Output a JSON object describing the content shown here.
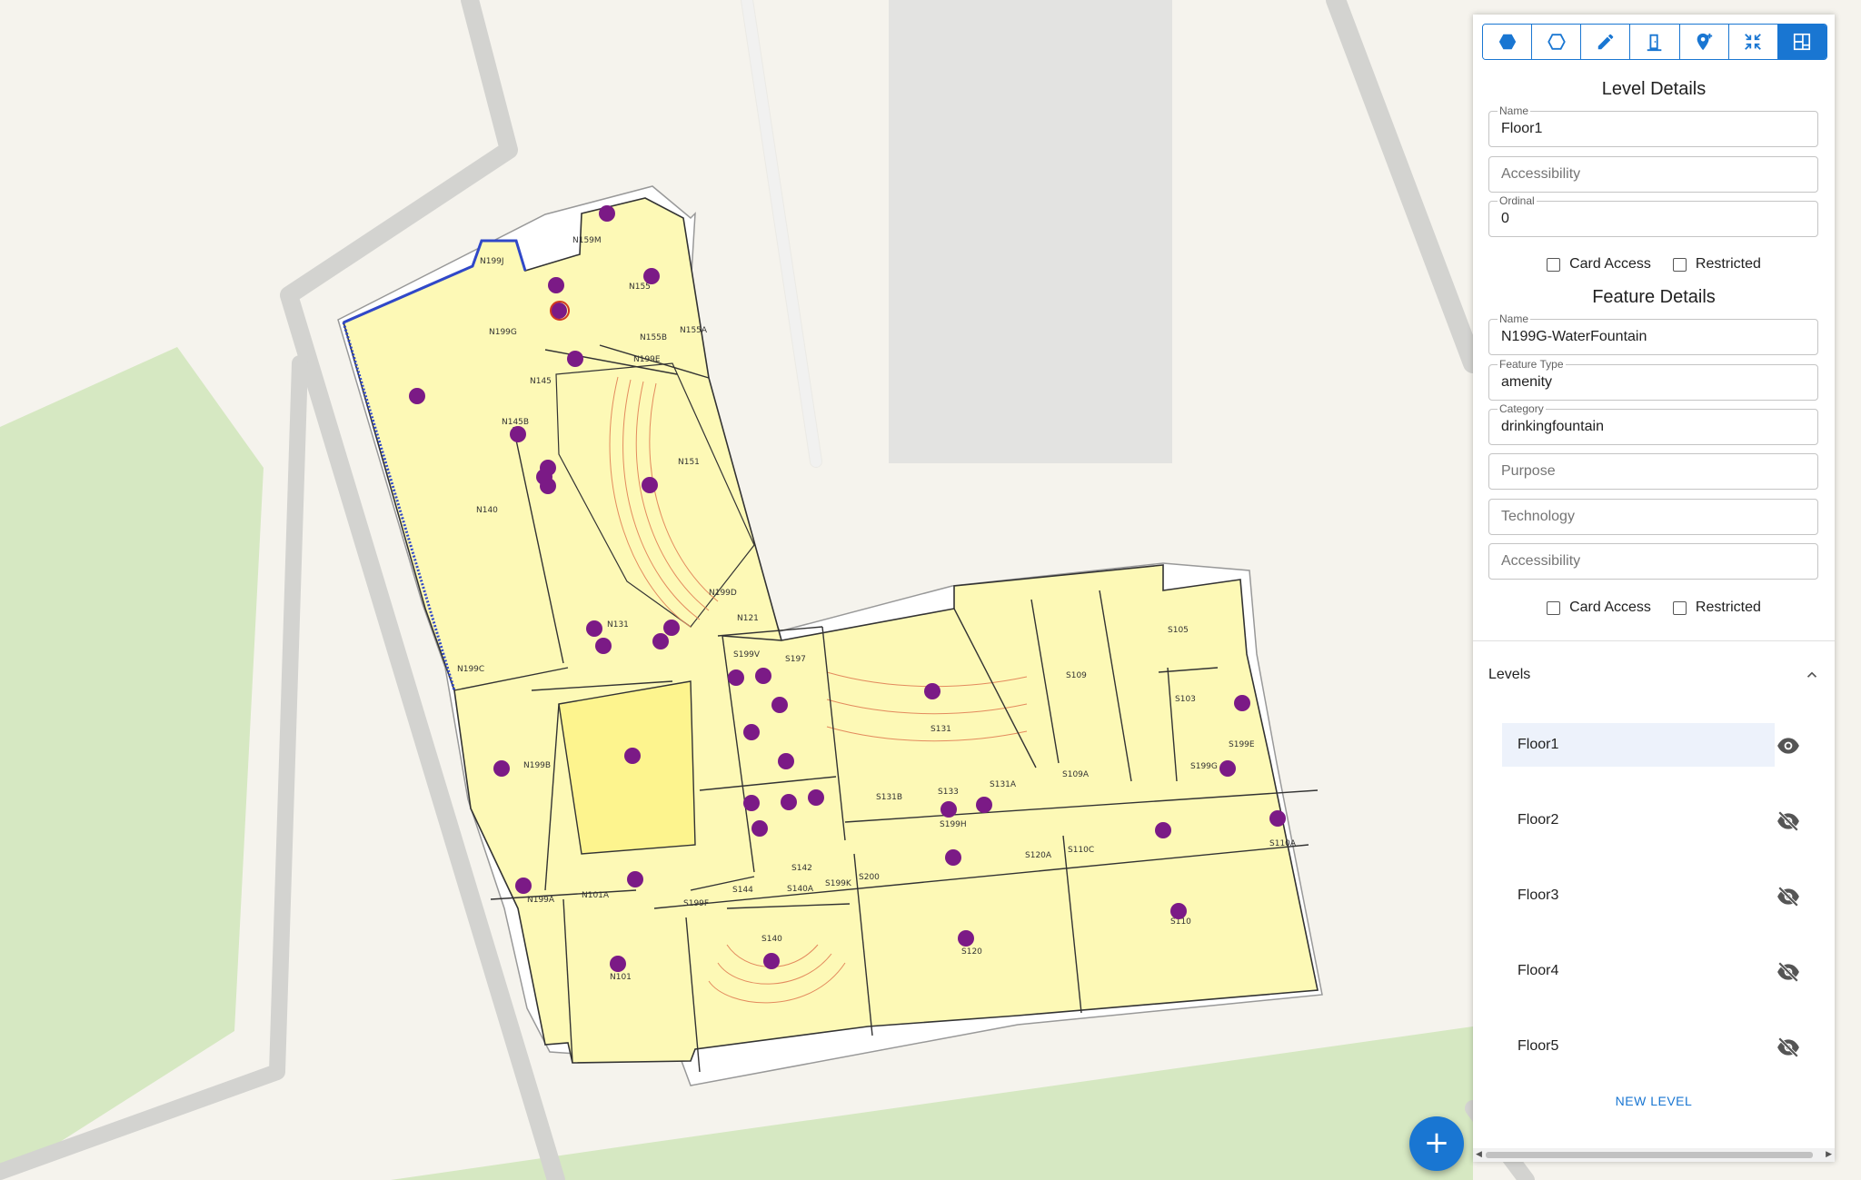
{
  "toolbar": {
    "buttons": [
      {
        "name": "draw-polygon-filled",
        "icon": "hexagon-filled-icon"
      },
      {
        "name": "draw-polygon-outline",
        "icon": "hexagon-outline-icon"
      },
      {
        "name": "edit",
        "icon": "pencil-icon"
      },
      {
        "name": "door",
        "icon": "door-icon"
      },
      {
        "name": "add-location",
        "icon": "add-location-icon"
      },
      {
        "name": "collapse",
        "icon": "collapse-arrows-icon"
      },
      {
        "name": "floorplan",
        "icon": "floorplan-grid-icon",
        "active": true
      }
    ]
  },
  "level_details": {
    "title": "Level Details",
    "name_label": "Name",
    "name_value": "Floor1",
    "accessibility_placeholder": "Accessibility",
    "ordinal_label": "Ordinal",
    "ordinal_value": "0",
    "card_access_label": "Card Access",
    "restricted_label": "Restricted"
  },
  "feature_details": {
    "title": "Feature Details",
    "name_label": "Name",
    "name_value": "N199G-WaterFountain",
    "type_label": "Feature Type",
    "type_value": "amenity",
    "category_label": "Category",
    "category_value": "drinkingfountain",
    "purpose_placeholder": "Purpose",
    "technology_placeholder": "Technology",
    "accessibility_placeholder": "Accessibility",
    "card_access_label": "Card Access",
    "restricted_label": "Restricted"
  },
  "levels": {
    "title": "Levels",
    "items": [
      {
        "label": "Floor1",
        "visible": true
      },
      {
        "label": "Floor2",
        "visible": false
      },
      {
        "label": "Floor3",
        "visible": false
      },
      {
        "label": "Floor4",
        "visible": false
      },
      {
        "label": "Floor5",
        "visible": false
      }
    ],
    "new_level_label": "NEW LEVEL"
  },
  "fab": {
    "label": "+"
  },
  "map": {
    "room_labels": [
      "N159M",
      "N199J",
      "N155",
      "N199G",
      "N155B",
      "N155A",
      "N199E",
      "N145",
      "N145B",
      "N151",
      "N140",
      "N199D",
      "N121",
      "N131",
      "S199V",
      "S197",
      "N199C",
      "N199B",
      "S131",
      "S109",
      "S105",
      "S103",
      "S199E",
      "S109A",
      "S199G",
      "S131B",
      "S133",
      "S131A",
      "S199H",
      "S120A",
      "S110C",
      "S110A",
      "N101A",
      "N199A",
      "S144",
      "S142",
      "S140A",
      "S199K",
      "S199F",
      "S200",
      "S140",
      "S120",
      "S110",
      "N101"
    ],
    "colors": {
      "room_fill": "#fdf9b6",
      "feature_dot": "#7b1a86",
      "map_bg": "#f5f3ed",
      "park": "#d6e8c2",
      "road": "#d9d9d6",
      "accent": "#1976d2"
    }
  }
}
